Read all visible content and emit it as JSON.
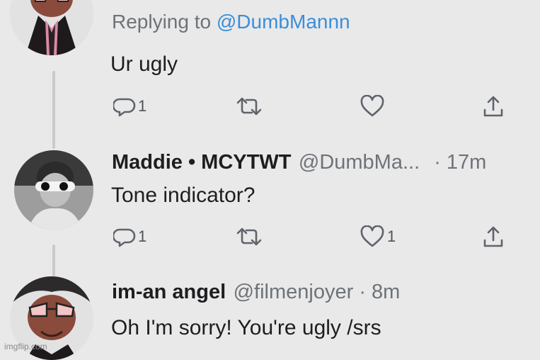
{
  "tweets": [
    {
      "reply_prefix": "Replying to ",
      "reply_mention": "@DumbMannn",
      "text": "Ur ugly",
      "actions": {
        "reply_count": "1",
        "retweet_count": "",
        "like_count": ""
      }
    },
    {
      "name": "Maddie • MCYTWT",
      "handle": "@DumbMa...",
      "time": " · 17m",
      "text": "Tone indicator?",
      "actions": {
        "reply_count": "1",
        "retweet_count": "",
        "like_count": "1"
      }
    },
    {
      "name": "im-an angel",
      "handle": "@filmenjoyer",
      "time": " · 8m",
      "text": "Oh I'm sorry! You're ugly /srs"
    }
  ],
  "watermark": "imgflip.com",
  "icons": [
    "reply-icon",
    "retweet-icon",
    "like-icon",
    "share-icon"
  ],
  "colors": {
    "background": "#e9e9ea",
    "mention": "#3b8ed8",
    "secondary_text": "#6e7378"
  }
}
